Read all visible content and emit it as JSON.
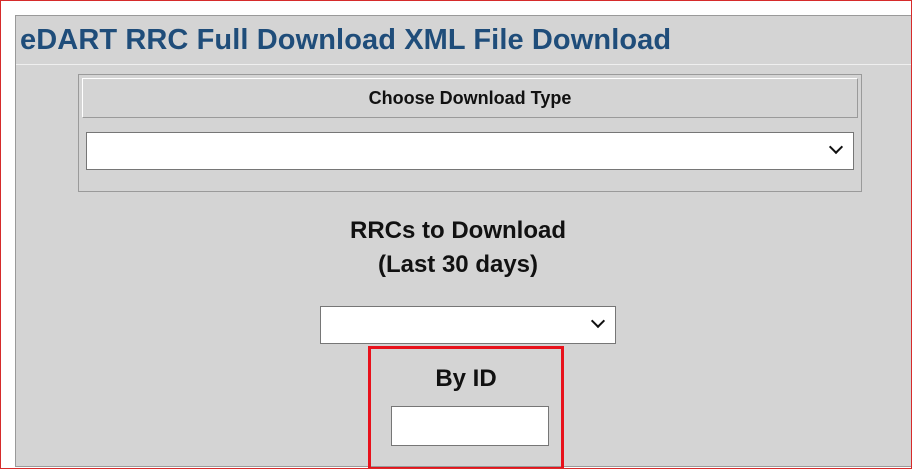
{
  "page": {
    "title": "eDART RRC Full Download XML File Download"
  },
  "download_type": {
    "header": "Choose Download Type",
    "selected_value": ""
  },
  "rrcs": {
    "label_line1": "RRCs to Download",
    "label_line2": "(Last 30 days)",
    "selected_value": ""
  },
  "by_id": {
    "label": "By ID",
    "value": ""
  },
  "icons": {
    "dropdown": "chevron-down-icon"
  },
  "colors": {
    "title": "#1f4d7a",
    "panel_background": "#d4d4d4",
    "highlight": "#e8111b",
    "frame_border": "#d62b2b"
  }
}
